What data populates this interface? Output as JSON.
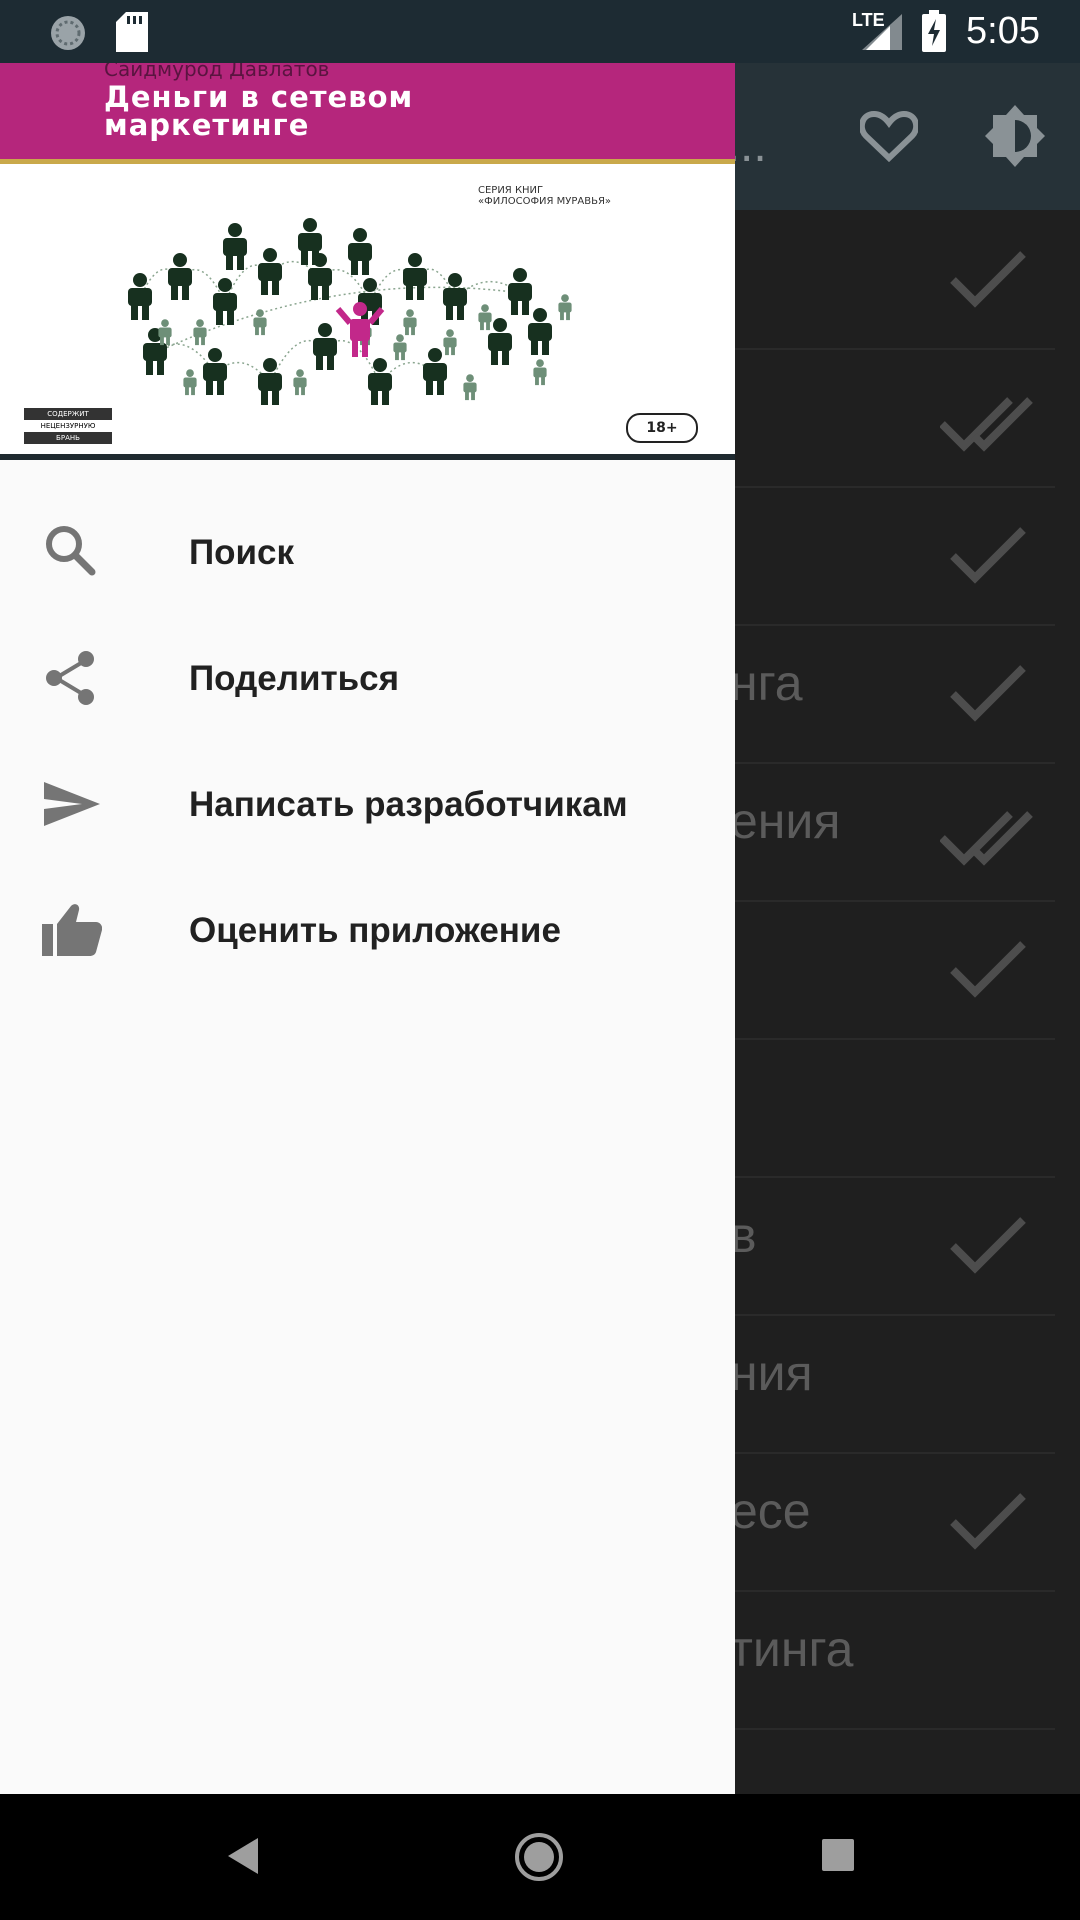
{
  "status_bar": {
    "network": "LTE",
    "time": "5:05"
  },
  "app_bar": {
    "title_fragment": "о..."
  },
  "list_rows": [
    {
      "fragment": "",
      "status": "check"
    },
    {
      "fragment": "",
      "status": "double-check"
    },
    {
      "fragment": "",
      "status": "check"
    },
    {
      "fragment": "нга",
      "status": "check"
    },
    {
      "fragment": "ения",
      "status": "double-check"
    },
    {
      "fragment": "",
      "status": "check"
    },
    {
      "fragment": "",
      "status": "none"
    },
    {
      "fragment": "в",
      "status": "check"
    },
    {
      "fragment": "ния",
      "status": "none"
    },
    {
      "fragment": "есе",
      "status": "check"
    },
    {
      "fragment": "тинга",
      "status": "none"
    }
  ],
  "cover": {
    "author": "Саидмурод Давлатов",
    "title_line1": "Деньги в сетевом",
    "title_line2": "маркетинге",
    "series_line1": "СЕРИЯ КНИГ",
    "series_line2": "«ФИЛОСОФИЯ МУРАВЬЯ»",
    "stamp_line1": "СОДЕРЖИТ",
    "stamp_line2": "НЕЦЕНЗУРНУЮ",
    "stamp_line3": "БРАНЬ",
    "age_rating": "18+"
  },
  "drawer_menu": [
    {
      "label": "Поиск",
      "icon": "search-icon"
    },
    {
      "label": "Поделиться",
      "icon": "share-icon"
    },
    {
      "label": "Написать разработчикам",
      "icon": "send-icon"
    },
    {
      "label": "Оценить приложение",
      "icon": "thumb-up-icon"
    }
  ],
  "colors": {
    "cover_band": "#b5267c",
    "drawer_bg": "#fafafa",
    "status_bar": "#1d2b33",
    "app_bar": "#263238"
  }
}
